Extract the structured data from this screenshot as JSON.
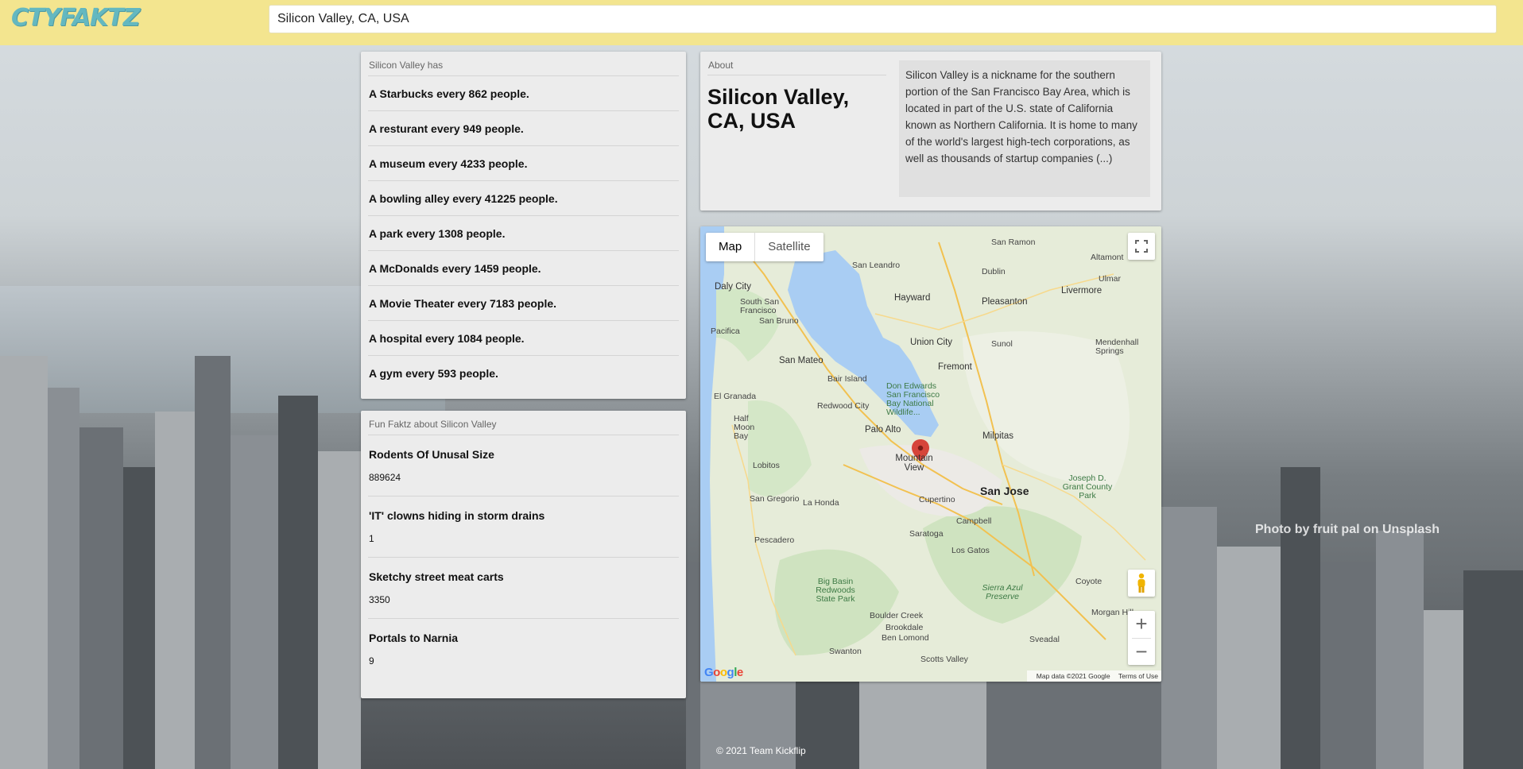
{
  "app": {
    "logo": "CTYFAKTZ"
  },
  "search": {
    "value": "Silicon Valley, CA, USA"
  },
  "stats": {
    "caption": "Silicon Valley has",
    "items": [
      "A Starbucks every 862 people.",
      "A resturant every 949 people.",
      "A museum every 4233 people.",
      "A bowling alley every 41225 people.",
      "A park every 1308 people.",
      "A McDonalds every 1459 people.",
      "A Movie Theater every 7183 people.",
      "A hospital every 1084 people.",
      "A gym every 593 people."
    ]
  },
  "funfacts": {
    "caption": "Fun Faktz about Silicon Valley",
    "items": [
      {
        "title": "Rodents Of Unusal Size",
        "value": "889624"
      },
      {
        "title": "'IT' clowns hiding in storm drains",
        "value": "1"
      },
      {
        "title": "Sketchy street meat carts",
        "value": "3350"
      },
      {
        "title": "Portals to Narnia",
        "value": "9"
      }
    ]
  },
  "about": {
    "caption": "About",
    "title": "Silicon Valley, CA, USA",
    "description": "Silicon Valley is a nickname for the southern portion of the San Francisco Bay Area, which is located in part of the U.S. state of California known as Northern California. It is home to many of the world's largest high-tech corporations, as well as thousands of startup companies (...)"
  },
  "map": {
    "type_map": "Map",
    "type_satellite": "Satellite",
    "google": "Google",
    "attribution": "Map data ©2021 Google",
    "terms": "Terms of Use",
    "labels": {
      "san_ramon": "San Ramon",
      "san_leandro": "San Leandro",
      "altamont": "Altamont",
      "dublin": "Dublin",
      "ulmar": "Ulmar",
      "livermore": "Livermore",
      "daly_city": "Daly City",
      "hayward": "Hayward",
      "pleasanton": "Pleasanton",
      "south_sf": "South San Francisco",
      "san_bruno": "San Bruno",
      "pacifica": "Pacifica",
      "union_city": "Union City",
      "sunol": "Sunol",
      "mendenhall": "Mendenhall Springs",
      "san_mateo": "San Mateo",
      "fremont": "Fremont",
      "bair_island": "Bair Island",
      "el_granada": "El Granada",
      "redwood_city": "Redwood City",
      "don_edwards": "Don Edwards San Francisco Bay National Wildlife...",
      "half_moon_bay": "Half Moon Bay",
      "palo_alto": "Palo Alto",
      "milpitas": "Milpitas",
      "mountain_view": "Mountain View",
      "lobitos": "Lobitos",
      "san_jose": "San Jose",
      "joseph_grant": "Joseph D. Grant County Park",
      "san_gregorio": "San Gregorio",
      "la_honda": "La Honda",
      "cupertino": "Cupertino",
      "campbell": "Campbell",
      "saratoga": "Saratoga",
      "pescadero": "Pescadero",
      "los_gatos": "Los Gatos",
      "big_basin": "Big Basin Redwoods State Park",
      "sierra_azul": "Sierra Azul Preserve",
      "coyote": "Coyote",
      "morgan_hill": "Morgan Hill",
      "boulder_creek": "Boulder Creek",
      "brookdale": "Brookdale",
      "ben_lomond": "Ben Lomond",
      "swanton": "Swanton",
      "sveadal": "Sveadal",
      "scotts_valley": "Scotts Valley"
    }
  },
  "credit": "Photo by fruit pal on Unsplash",
  "footer": "© 2021 Team Kickflip"
}
